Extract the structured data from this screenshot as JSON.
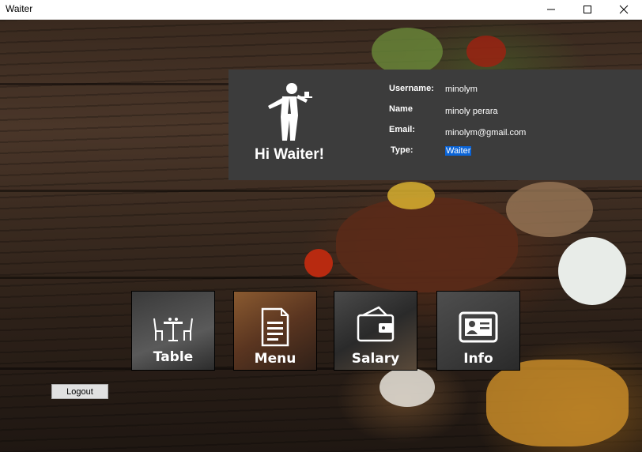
{
  "window": {
    "title": "Waiter"
  },
  "profile": {
    "greeting": "Hi Waiter!",
    "username_label": "Username:",
    "username_value": "minolym",
    "name_label": "Name",
    "name_value": "minoly perara",
    "email_label": "Email:",
    "email_value": "minolym@gmail.com",
    "type_label": "Type:",
    "type_value": "Waiter"
  },
  "tiles": {
    "table": "Table",
    "menu": "Menu",
    "salary": "Salary",
    "info": "Info"
  },
  "actions": {
    "logout": "Logout"
  },
  "icons": {
    "waiter": "waiter-icon",
    "table": "dining-table-icon",
    "menu": "menu-document-icon",
    "salary": "wallet-icon",
    "info": "id-card-icon"
  },
  "colors": {
    "card_bg": "#3c3c3c",
    "selection": "#0a64d8"
  }
}
